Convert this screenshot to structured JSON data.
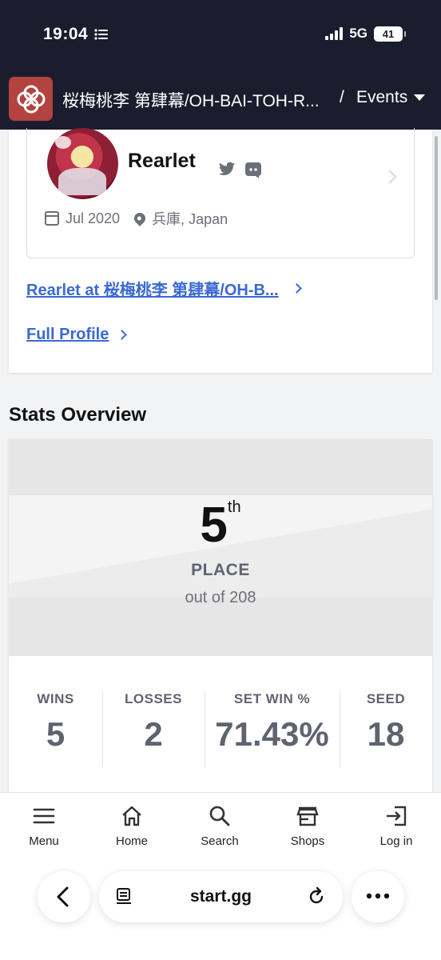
{
  "status_bar": {
    "time": "19:04",
    "network": "5G",
    "battery": "41"
  },
  "header": {
    "org_title": "桜梅桃李 第肆幕/OH-BAI-TOH-R...",
    "separator": "/",
    "events_label": "Events"
  },
  "profile": {
    "name": "Rearlet",
    "joined": "Jul 2020",
    "location": "兵庫, Japan",
    "team_link": "Rearlet at 桜梅桃李 第肆幕/OH-B...",
    "full_profile": "Full Profile"
  },
  "stats": {
    "section_title": "Stats Overview",
    "place_number": "5",
    "place_suffix": "th",
    "place_label": "PLACE",
    "place_sub": "out of 208",
    "items": [
      {
        "label": "WINS",
        "value": "5"
      },
      {
        "label": "LOSSES",
        "value": "2"
      },
      {
        "label": "SET WIN %",
        "value": "71.43%"
      },
      {
        "label": "SEED",
        "value": "18"
      }
    ]
  },
  "bottom_nav": [
    {
      "label": "Menu",
      "icon": "menu-icon"
    },
    {
      "label": "Home",
      "icon": "home-icon"
    },
    {
      "label": "Search",
      "icon": "search-icon"
    },
    {
      "label": "Shops",
      "icon": "shop-icon"
    },
    {
      "label": "Log in",
      "icon": "login-icon"
    }
  ],
  "browser": {
    "url": "start.gg"
  },
  "colors": {
    "header_bg": "#1b1d2e",
    "link": "#3a69d4",
    "logo_bg": "#b3433e"
  }
}
